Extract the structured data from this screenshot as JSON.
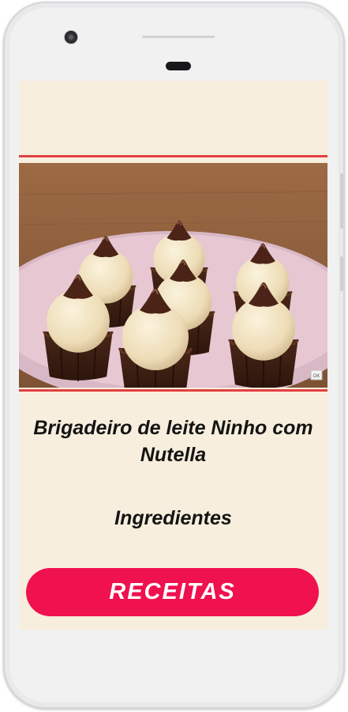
{
  "recipe": {
    "title": "Brigadeiro de leite Ninho com Nutella",
    "section_heading": "Ingredientes",
    "photo_badge": "OK"
  },
  "actions": {
    "recipes_button_label": "RECEITAS"
  },
  "colors": {
    "background": "#f8eedd",
    "accent_rule": "#e3403f",
    "button": "#f0114f",
    "text": "#141414"
  }
}
